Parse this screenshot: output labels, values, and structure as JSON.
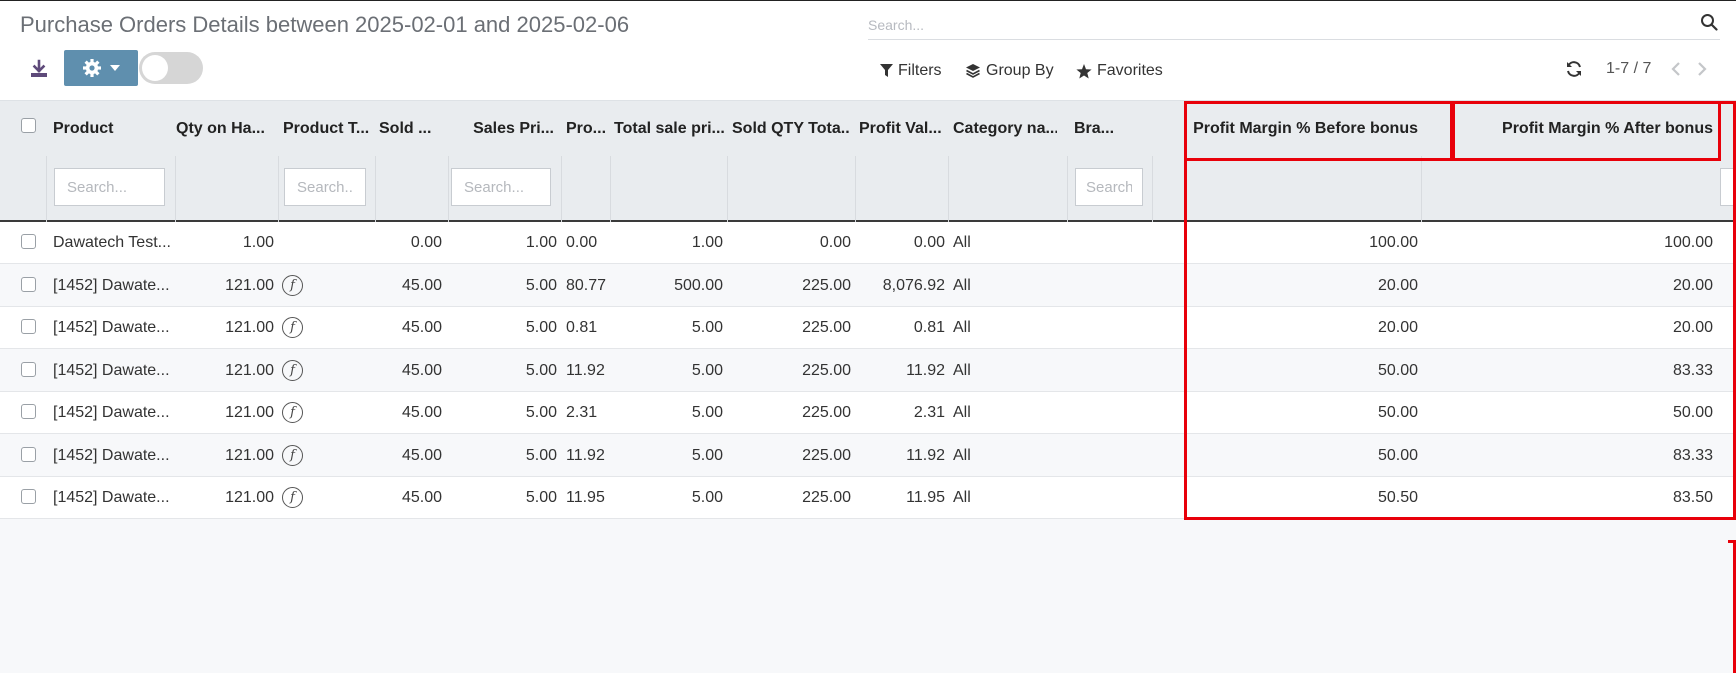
{
  "page": {
    "title": "Purchase Orders Details between 2025-02-01 and 2025-02-06"
  },
  "search": {
    "placeholder": "Search..."
  },
  "toolbar": {
    "filters_label": "Filters",
    "group_by_label": "Group By",
    "favorites_label": "Favorites"
  },
  "pager": {
    "text": "1-7 / 7"
  },
  "columns": [
    {
      "label": "Product",
      "filter_placeholder": "Search..."
    },
    {
      "label": "Qty on Ha..."
    },
    {
      "label": "Product T...",
      "filter_placeholder": "Search..."
    },
    {
      "label": "Sold ..."
    },
    {
      "label": "Sales Pri...",
      "filter_placeholder": "Search..."
    },
    {
      "label": "Pro..."
    },
    {
      "label": "Total sale pri..."
    },
    {
      "label": "Sold QTY Tota..."
    },
    {
      "label": "Profit Val..."
    },
    {
      "label": "Category na..."
    },
    {
      "label": "Bra...",
      "filter_placeholder": "Search..."
    },
    {
      "label": "Profit Margin % Before bonus"
    },
    {
      "label": "Profit Margin % After bonus"
    }
  ],
  "rows": [
    {
      "product": "Dawatech Test...",
      "qty": "1.00",
      "ptype": "",
      "sold": "0.00",
      "sales_price": "1.00",
      "pro": "0.00",
      "total_sale": "1.00",
      "sold_total": "0.00",
      "profit_val": "0.00",
      "category": "All",
      "brand": "",
      "pm_before": "100.00",
      "pm_after": "100.00"
    },
    {
      "product": "[1452] Dawate...",
      "qty": "121.00",
      "ptype": "f",
      "sold": "45.00",
      "sales_price": "5.00",
      "pro": "80.77",
      "total_sale": "500.00",
      "sold_total": "225.00",
      "profit_val": "8,076.92",
      "category": "All",
      "brand": "",
      "pm_before": "20.00",
      "pm_after": "20.00"
    },
    {
      "product": "[1452] Dawate...",
      "qty": "121.00",
      "ptype": "f",
      "sold": "45.00",
      "sales_price": "5.00",
      "pro": "0.81",
      "total_sale": "5.00",
      "sold_total": "225.00",
      "profit_val": "0.81",
      "category": "All",
      "brand": "",
      "pm_before": "20.00",
      "pm_after": "20.00"
    },
    {
      "product": "[1452] Dawate...",
      "qty": "121.00",
      "ptype": "f",
      "sold": "45.00",
      "sales_price": "5.00",
      "pro": "11.92",
      "total_sale": "5.00",
      "sold_total": "225.00",
      "profit_val": "11.92",
      "category": "All",
      "brand": "",
      "pm_before": "50.00",
      "pm_after": "83.33"
    },
    {
      "product": "[1452] Dawate...",
      "qty": "121.00",
      "ptype": "f",
      "sold": "45.00",
      "sales_price": "5.00",
      "pro": "2.31",
      "total_sale": "5.00",
      "sold_total": "225.00",
      "profit_val": "2.31",
      "category": "All",
      "brand": "",
      "pm_before": "50.00",
      "pm_after": "50.00"
    },
    {
      "product": "[1452] Dawate...",
      "qty": "121.00",
      "ptype": "f",
      "sold": "45.00",
      "sales_price": "5.00",
      "pro": "11.92",
      "total_sale": "5.00",
      "sold_total": "225.00",
      "profit_val": "11.92",
      "category": "All",
      "brand": "",
      "pm_before": "50.00",
      "pm_after": "83.33"
    },
    {
      "product": "[1452] Dawate...",
      "qty": "121.00",
      "ptype": "f",
      "sold": "45.00",
      "sales_price": "5.00",
      "pro": "11.95",
      "total_sale": "5.00",
      "sold_total": "225.00",
      "profit_val": "11.95",
      "category": "All",
      "brand": "",
      "pm_before": "50.50",
      "pm_after": "83.50"
    }
  ],
  "icons": {
    "download": "download-icon",
    "gear": "gear-icon",
    "caret": "caret-down-icon",
    "search": "search-icon",
    "filter": "filter-icon",
    "group_by": "layers-icon",
    "favorites": "star-icon",
    "refresh": "refresh-icon",
    "prev": "chevron-left-icon",
    "next": "chevron-right-icon",
    "product_type": "f-circle-icon"
  },
  "colors": {
    "primary": "#5f8fae",
    "highlight": "#e8000a",
    "header_bg": "#e9ecef"
  }
}
